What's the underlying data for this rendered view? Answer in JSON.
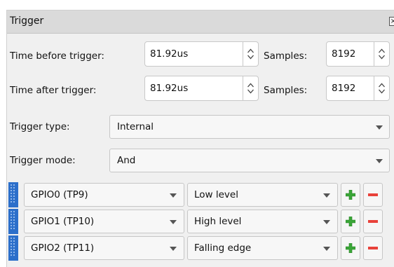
{
  "window": {
    "title": "Trigger"
  },
  "before": {
    "label": "Time before trigger:",
    "time_value": "81.92us",
    "samples_label": "Samples:",
    "samples_value": "8192"
  },
  "after": {
    "label": "Time after trigger:",
    "time_value": "81.92us",
    "samples_label": "Samples:",
    "samples_value": "8192"
  },
  "trigger_type": {
    "label": "Trigger type:",
    "value": "Internal"
  },
  "trigger_mode": {
    "label": "Trigger mode:",
    "value": "And"
  },
  "conditions": [
    {
      "source": "GPIO0 (TP9)",
      "condition": "Low level"
    },
    {
      "source": "GPIO1 (TP10)",
      "condition": "High level"
    },
    {
      "source": "GPIO2 (TP11)",
      "condition": "Falling edge"
    }
  ],
  "colors": {
    "add": "#3aa637",
    "remove": "#e8413a",
    "handle": "#2c6fca"
  },
  "icons": {
    "add": "plus-icon",
    "remove": "minus-icon",
    "close": "close-icon",
    "drag": "drag-handle-icon"
  }
}
